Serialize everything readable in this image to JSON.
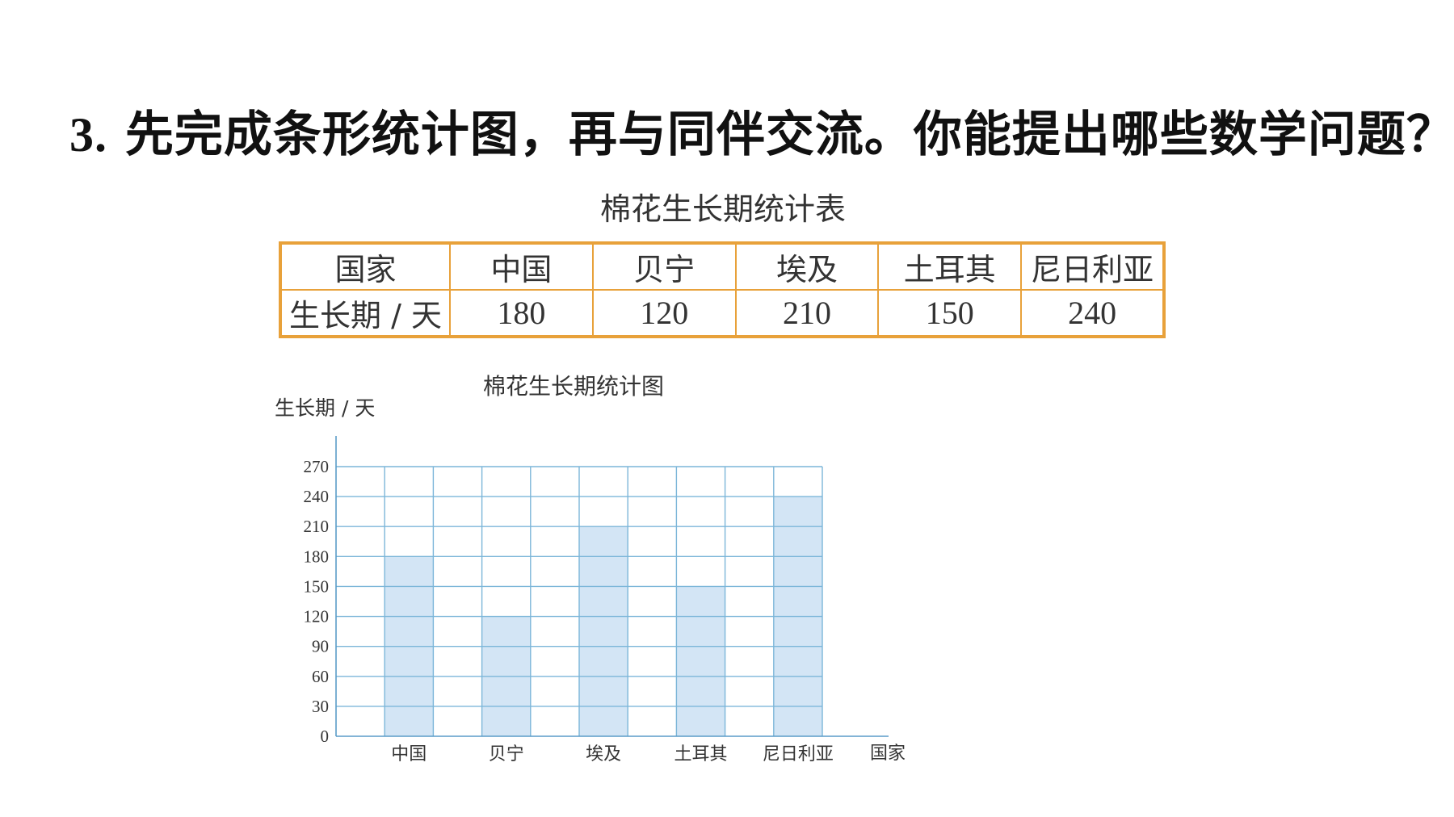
{
  "question": {
    "number": "3.",
    "text": "先完成条形统计图，再与同伴交流。你能提出哪些数学问题？"
  },
  "table": {
    "title": "棉花生长期统计表",
    "header": [
      "国家",
      "中国",
      "贝宁",
      "埃及",
      "土耳其",
      "尼日利亚"
    ],
    "row": [
      "生长期 / 天",
      "180",
      "120",
      "210",
      "150",
      "240"
    ]
  },
  "chart_data": {
    "type": "bar",
    "title": "棉花生长期统计图",
    "ylabel": "生长期 / 天",
    "xlabel": "国家",
    "categories": [
      "中国",
      "贝宁",
      "埃及",
      "土耳其",
      "尼日利亚"
    ],
    "values": [
      180,
      120,
      210,
      150,
      240
    ],
    "ylim": [
      0,
      270
    ],
    "yticks": [
      0,
      30,
      60,
      90,
      120,
      150,
      180,
      210,
      240,
      270
    ],
    "grid": true,
    "colors": {
      "bar": "#d3e5f5",
      "grid": "#7cb6d9",
      "axis": "#5a9cc8"
    }
  }
}
